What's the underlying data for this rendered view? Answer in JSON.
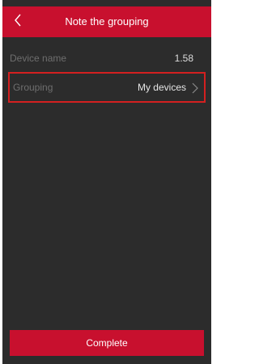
{
  "header": {
    "title": "Note the grouping",
    "back_icon": "chevron-left-icon"
  },
  "device_row": {
    "label": "Device name",
    "value": "1.58"
  },
  "grouping_row": {
    "label": "Grouping",
    "value": "My devices",
    "icon": "chevron-right-icon"
  },
  "footer": {
    "complete_label": "Complete"
  },
  "colors": {
    "accent": "#c8102e",
    "background": "#2c2c2c",
    "highlight_border": "#d42020"
  }
}
